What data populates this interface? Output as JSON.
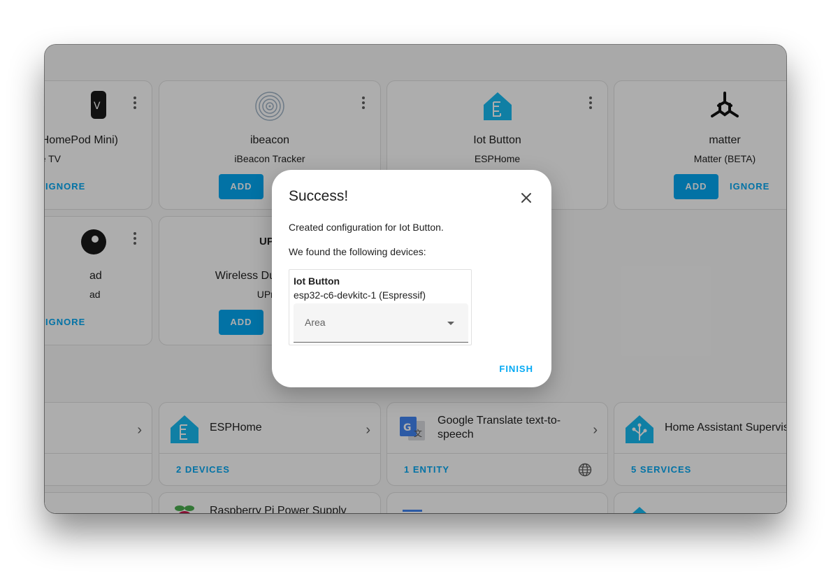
{
  "discovered": [
    {
      "title": "HomePod Mini)",
      "subtitle": "e TV",
      "ignore": "IGNORE"
    },
    {
      "title": "ibeacon",
      "subtitle": "iBeacon Tracker",
      "add": "ADD"
    },
    {
      "title": "Iot Button",
      "subtitle": "ESPHome"
    },
    {
      "title": "matter",
      "subtitle": "Matter (BETA)",
      "add": "ADD",
      "ignore": "IGNORE"
    },
    {
      "title": "ad",
      "subtitle": "ad",
      "ignore": "IGNORE"
    },
    {
      "title": "Wireless Dual Band C",
      "subtitle": "UPnP",
      "add": "ADD",
      "logo_text": "UPn"
    }
  ],
  "integrations": [
    {
      "name": "ESPHome",
      "footer": "2 DEVICES"
    },
    {
      "name": "Google Translate text-to-speech",
      "footer": "1 ENTITY"
    },
    {
      "name": "Home Assistant Supervis",
      "footer": "5 SERVICES"
    },
    {
      "name": "Raspberry Pi Power Supply"
    }
  ],
  "dialog": {
    "title": "Success!",
    "line1": "Created configuration for Iot Button.",
    "line2": "We found the following devices:",
    "device_name": "Iot Button",
    "device_model": "esp32-c6-devkitc-1 (Espressif)",
    "area_label": "Area",
    "finish": "FINISH"
  },
  "colors": {
    "accent": "#03a9f4",
    "esphome": "#18bcf2",
    "scrim": "rgba(0,0,0,0.32)"
  }
}
